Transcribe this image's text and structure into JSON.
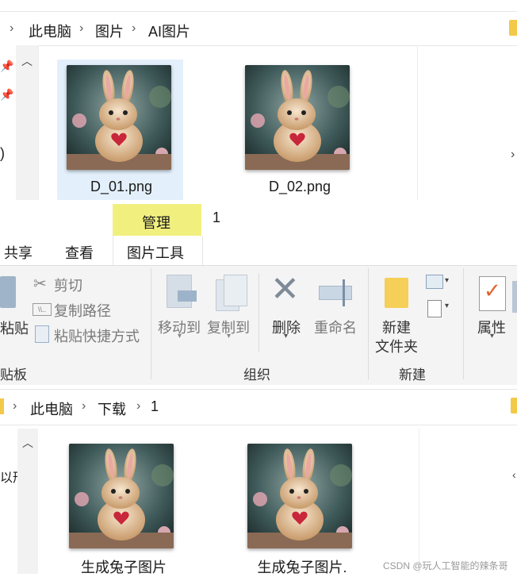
{
  "top_window": {
    "breadcrumb": [
      "此电脑",
      "图片",
      "AI图片"
    ],
    "files": [
      {
        "name": "D_01.png",
        "selected": true
      },
      {
        "name": "D_02.png",
        "selected": false
      }
    ],
    "left_edge_text": ")"
  },
  "ribbon": {
    "context_tab_group": "管理",
    "context_title": "1",
    "tabs": [
      "共享",
      "查看",
      "图片工具"
    ],
    "clipboard": {
      "paste_label_partial": "粘贴",
      "cut": "剪切",
      "copy_path": "复制路径",
      "paste_shortcut": "粘贴快捷方式",
      "group_label_partial": "贴板"
    },
    "organize": {
      "move_to": "移动到",
      "copy_to": "复制到",
      "delete": "删除",
      "rename": "重命名",
      "group_label": "组织"
    },
    "new": {
      "new_folder_line1": "新建",
      "new_folder_line2": "文件夹",
      "group_label": "新建"
    },
    "open": {
      "properties": "属性"
    }
  },
  "bottom_window": {
    "breadcrumb": [
      "此电脑",
      "下载",
      "1"
    ],
    "files": [
      {
        "name": "生成兔子图片"
      },
      {
        "name": "生成兔子图片."
      }
    ],
    "left_edge_text": "以形"
  },
  "watermark": "CSDN @玩人工智能的辣条哥"
}
